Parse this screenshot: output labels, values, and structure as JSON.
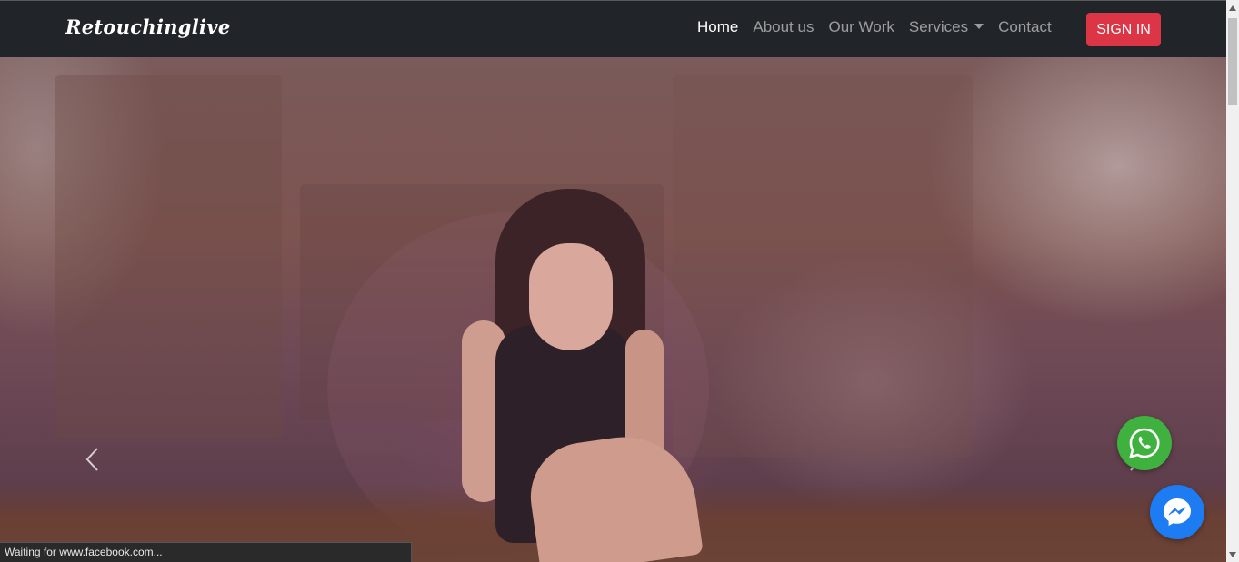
{
  "navbar": {
    "brand": "Retouchinglive",
    "links": [
      {
        "label": "Home",
        "active": true
      },
      {
        "label": "About us",
        "active": false
      },
      {
        "label": "Our Work",
        "active": false
      },
      {
        "label": "Services",
        "active": false,
        "dropdown": true
      },
      {
        "label": "Contact",
        "active": false
      }
    ],
    "signin_label": "SIGN IN"
  },
  "hero": {
    "prev_icon": "chevron-left-icon",
    "next_icon": "chevron-right-icon"
  },
  "floating": {
    "whatsapp_icon": "whatsapp-icon",
    "messenger_icon": "messenger-icon"
  },
  "status_text": "Waiting for www.facebook.com...",
  "colors": {
    "navbar": "#212529",
    "signin": "#dc3545",
    "whatsapp": "#3fb13f",
    "messenger": "#1d7cf2"
  }
}
